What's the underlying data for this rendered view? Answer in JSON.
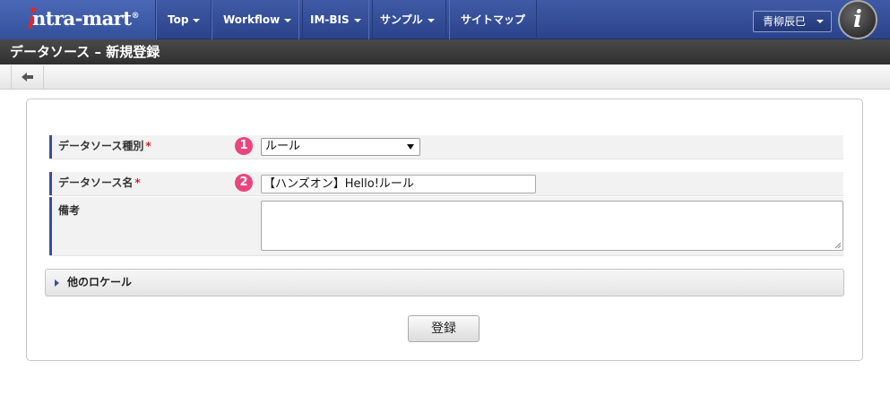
{
  "brand": {
    "logo_text": "ntra-mart",
    "logo_reg": "®"
  },
  "nav": {
    "items": [
      {
        "label": "Top",
        "has_dropdown": true
      },
      {
        "label": "Workflow",
        "has_dropdown": true
      },
      {
        "label": "IM-BIS",
        "has_dropdown": true
      },
      {
        "label": "サンプル",
        "has_dropdown": true
      },
      {
        "label": "サイトマップ",
        "has_dropdown": false
      }
    ],
    "user_name": "青柳辰巳",
    "avatar_letter": "i"
  },
  "page": {
    "title": "データソース – 新規登録"
  },
  "form": {
    "type_row": {
      "label": "データソース種別",
      "required_mark": "*",
      "badge": "1",
      "value": "ルール"
    },
    "name_row": {
      "label": "データソース名",
      "required_mark": "*",
      "badge": "2",
      "value": "【ハンズオン】Hello!ルール"
    },
    "notes_row": {
      "label": "備考",
      "value": ""
    },
    "locale_section": "他のロケール",
    "submit_label": "登録"
  },
  "colors": {
    "navbar": "#2c438a",
    "accent": "#3a4f96",
    "badge": "#e8467c",
    "required": "#d9212c"
  }
}
